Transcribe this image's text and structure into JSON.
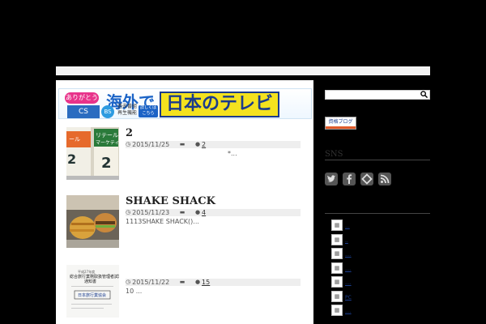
{
  "banner": {
    "pill": "ありがとう",
    "headline": "海外で",
    "cs": "CS",
    "bs": "BS",
    "small": "過去番組\n再生機能",
    "button": "詳しくは\nこちら",
    "big": "日本のテレビ"
  },
  "posts": [
    {
      "title": "2",
      "date": "2015/11/25",
      "comments": "2",
      "excerpt": "*..."
    },
    {
      "title": "SHAKE SHACK",
      "date": "2015/11/23",
      "comments": "4",
      "excerpt": "1113SHAKE SHACK()..."
    },
    {
      "title": "",
      "date": "2015/11/22",
      "comments": "15",
      "excerpt": "10                                            ..."
    }
  ],
  "icons": {
    "clock": "clock-icon",
    "folder": "folder-icon",
    "comment": "comment-icon",
    "search": "search-icon"
  },
  "sidebar": {
    "blog_badge": "資格ブログ",
    "sns_title": "SNS",
    "sns": [
      "twitter-icon",
      "facebook-icon",
      "feedly-icon",
      "rss-icon"
    ],
    "list": [
      "...",
      "..",
      "....",
      "....",
      "....",
      "PC",
      "...."
    ]
  },
  "colors": {
    "background": "#000000",
    "link": "#1a3d8f",
    "meta_bar": "#eeeeee"
  }
}
